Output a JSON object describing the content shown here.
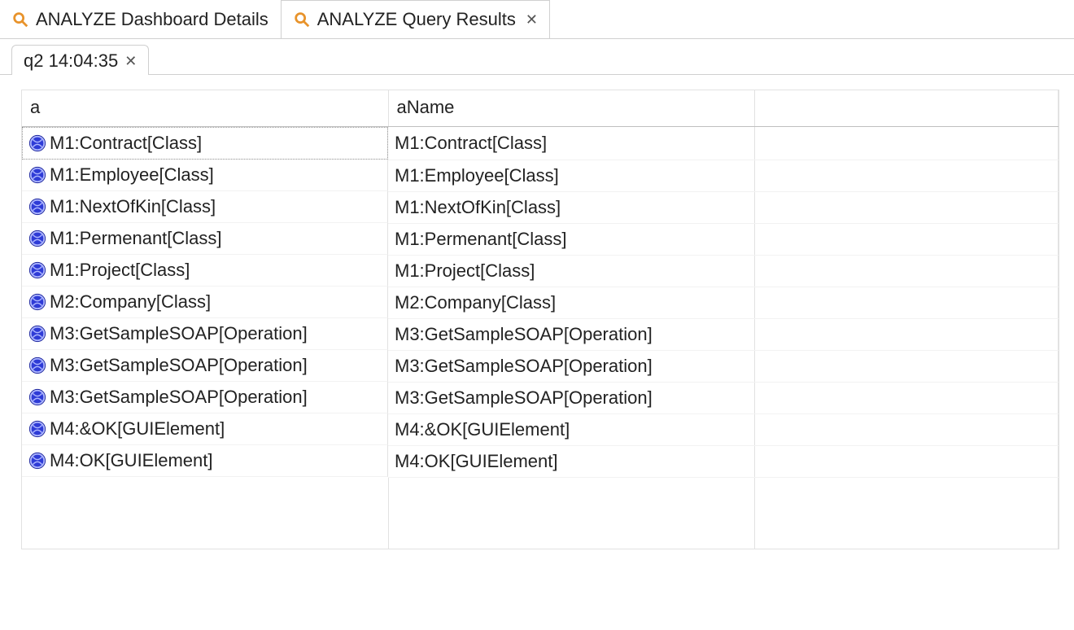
{
  "topTabs": [
    {
      "label": "ANALYZE Dashboard Details",
      "active": false,
      "closable": false
    },
    {
      "label": "ANALYZE Query Results",
      "active": true,
      "closable": true
    }
  ],
  "subTab": {
    "label": "q2 14:04:35"
  },
  "columns": [
    "a",
    "aName"
  ],
  "rows": [
    {
      "a": "M1:Contract[Class]",
      "aName": "M1:Contract[Class]"
    },
    {
      "a": "M1:Employee[Class]",
      "aName": "M1:Employee[Class]"
    },
    {
      "a": "M1:NextOfKin[Class]",
      "aName": "M1:NextOfKin[Class]"
    },
    {
      "a": "M1:Permenant[Class]",
      "aName": "M1:Permenant[Class]"
    },
    {
      "a": "M1:Project[Class]",
      "aName": "M1:Project[Class]"
    },
    {
      "a": "M2:Company[Class]",
      "aName": "M2:Company[Class]"
    },
    {
      "a": "M3:GetSampleSOAP[Operation]",
      "aName": "M3:GetSampleSOAP[Operation]"
    },
    {
      "a": "M3:GetSampleSOAP[Operation]",
      "aName": "M3:GetSampleSOAP[Operation]"
    },
    {
      "a": "M3:GetSampleSOAP[Operation]",
      "aName": "M3:GetSampleSOAP[Operation]"
    },
    {
      "a": "M4:&OK[GUIElement]",
      "aName": "M4:&OK[GUIElement]"
    },
    {
      "a": "M4:OK[GUIElement]",
      "aName": "M4:OK[GUIElement]"
    }
  ]
}
